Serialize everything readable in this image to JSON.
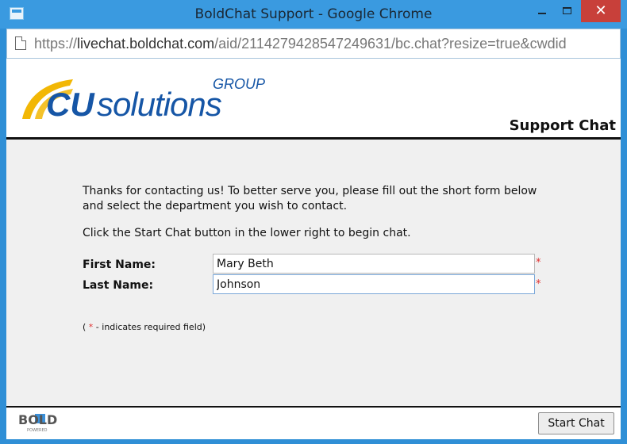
{
  "window": {
    "title": "BoldChat Support - Google Chrome",
    "close_glyph": "✕"
  },
  "address_bar": {
    "url_prefix": "https://",
    "url_domain": "livechat.boldchat.com",
    "url_path": "/aid/2114279428547249631/bc.chat?resize=true&cwdid"
  },
  "header": {
    "logo_group": "GROUP",
    "logo_cu": "CU",
    "logo_solutions": "solutions",
    "title": "Support Chat"
  },
  "form": {
    "intro_text": "Thanks for contacting us! To better serve you, please fill out the short form below and select the department you wish to contact.",
    "instruction_text": "Click the Start Chat button in the lower right to begin chat.",
    "first_name_label": "First Name:",
    "first_name_value": "Mary Beth",
    "last_name_label": "Last Name:",
    "last_name_value": "Johnson",
    "required_marker": "*",
    "note_open": "( ",
    "note_star": "*",
    "note_rest": " - indicates required field)"
  },
  "footer": {
    "brand_top": "BOLD",
    "brand_bottom": "POWERED",
    "start_button": "Start Chat"
  },
  "colors": {
    "titlebar": "#3a9ae0",
    "close_button": "#c8403a",
    "logo_blue": "#1656a6",
    "logo_yellow": "#f2b705",
    "required_red": "#e03030",
    "content_bg": "#f0f0f0"
  },
  "icons": {
    "window_icon": "app-window-icon",
    "page_icon": "page-icon",
    "minimize": "minimize-icon",
    "maximize": "maximize-icon",
    "close": "close-icon"
  }
}
